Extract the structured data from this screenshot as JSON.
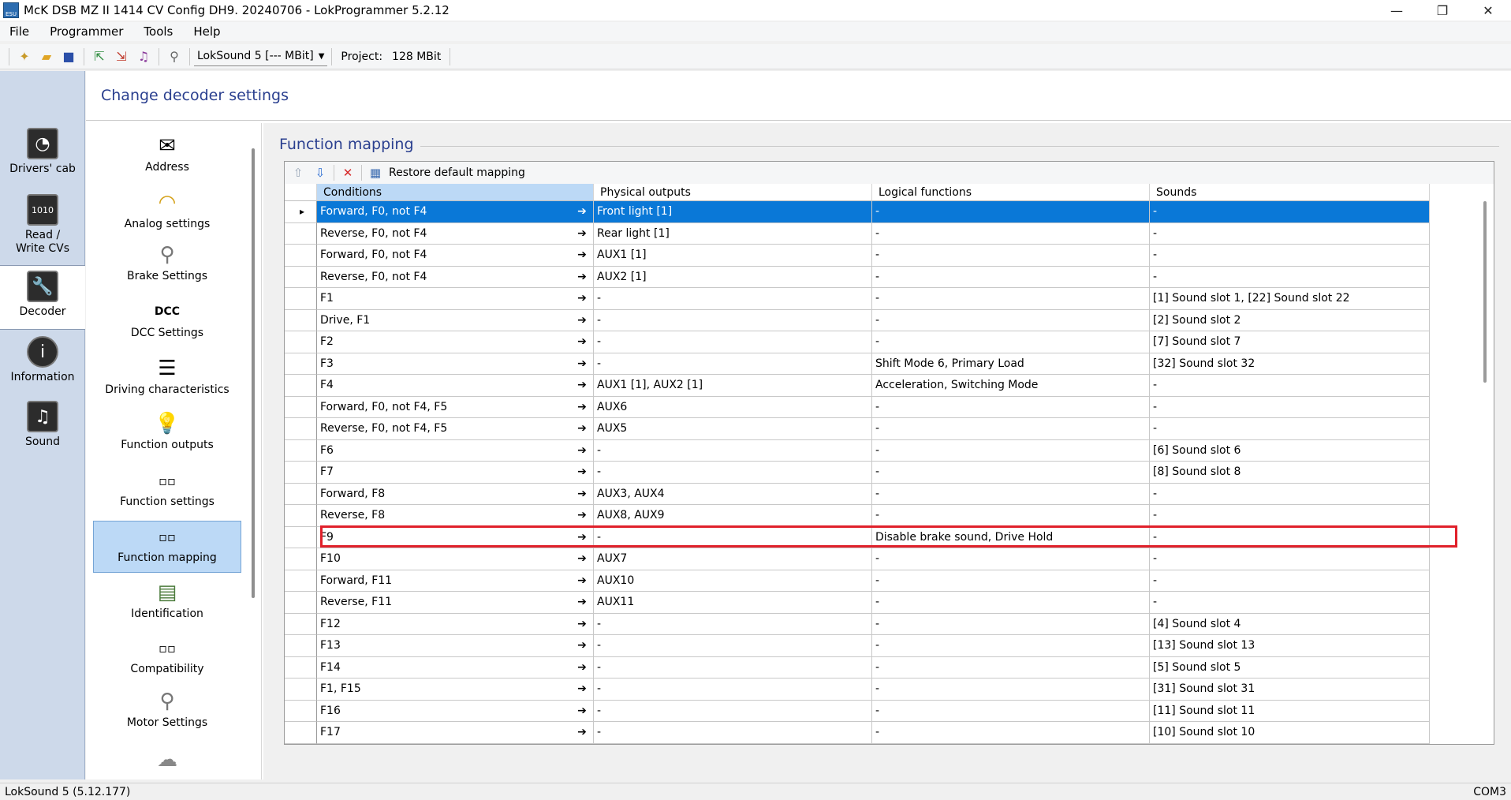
{
  "window": {
    "title": "McK DSB MZ II 1414 CV Config DH9. 20240706 - LokProgrammer 5.2.12",
    "controls": {
      "minimize": "—",
      "restore": "❐",
      "close": "✕"
    }
  },
  "menu": [
    "File",
    "Programmer",
    "Tools",
    "Help"
  ],
  "toolbar": {
    "decoder_combo": "LokSound 5 [--- MBit]",
    "project_label": "Project:",
    "project_value": "128 MBit"
  },
  "leftnav": [
    {
      "label": "Drivers' cab",
      "icon": "drivers-cab-icon"
    },
    {
      "label": "Read / Write CVs",
      "icon": "read-write-cvs-icon"
    },
    {
      "label": "Decoder",
      "icon": "decoder-wrench-icon",
      "active": true
    },
    {
      "label": "Information",
      "icon": "information-icon"
    },
    {
      "label": "Sound",
      "icon": "sound-notes-icon"
    }
  ],
  "main_title": "Change decoder settings",
  "categories": [
    {
      "label": "Address",
      "icon": "envelope-icon"
    },
    {
      "label": "Analog settings",
      "icon": "analog-gauge-icon"
    },
    {
      "label": "Brake Settings",
      "icon": "brake-lever-icon"
    },
    {
      "label": "DCC Settings",
      "icon": "dcc-icon"
    },
    {
      "label": "Driving characteristics",
      "icon": "sliders-icon"
    },
    {
      "label": "Function outputs",
      "icon": "light-bulb-icon"
    },
    {
      "label": "Function settings",
      "icon": "function-keys-icon"
    },
    {
      "label": "Function mapping",
      "icon": "function-keys-icon",
      "active": true
    },
    {
      "label": "Identification",
      "icon": "id-card-icon"
    },
    {
      "label": "Compatibility",
      "icon": "function-keys-icon"
    },
    {
      "label": "Motor Settings",
      "icon": "motor-lever-icon"
    },
    {
      "label": "",
      "icon": "smoke-icon"
    }
  ],
  "function_mapping": {
    "title": "Function mapping",
    "restore_label": "Restore default mapping",
    "columns": [
      "Conditions",
      "Physical outputs",
      "Logical functions",
      "Sounds"
    ],
    "rows": [
      {
        "conditions": "Forward, F0, not F4",
        "outputs": "Front light [1]",
        "logical": "-",
        "sounds": "-"
      },
      {
        "conditions": "Reverse, F0, not F4",
        "outputs": "Rear light [1]",
        "logical": "-",
        "sounds": "-"
      },
      {
        "conditions": "Forward, F0, not F4",
        "outputs": "AUX1 [1]",
        "logical": "-",
        "sounds": "-"
      },
      {
        "conditions": "Reverse, F0, not F4",
        "outputs": "AUX2 [1]",
        "logical": "-",
        "sounds": "-"
      },
      {
        "conditions": "F1",
        "outputs": "-",
        "logical": "-",
        "sounds": "[1] Sound slot 1, [22] Sound slot 22"
      },
      {
        "conditions": "Drive, F1",
        "outputs": "-",
        "logical": "-",
        "sounds": "[2] Sound slot 2"
      },
      {
        "conditions": "F2",
        "outputs": "-",
        "logical": "-",
        "sounds": "[7] Sound slot 7"
      },
      {
        "conditions": "F3",
        "outputs": "-",
        "logical": "Shift Mode 6, Primary Load",
        "sounds": "[32] Sound slot 32"
      },
      {
        "conditions": "F4",
        "outputs": "AUX1 [1], AUX2 [1]",
        "logical": "Acceleration, Switching Mode",
        "sounds": "-"
      },
      {
        "conditions": "Forward, F0, not F4, F5",
        "outputs": "AUX6",
        "logical": "-",
        "sounds": "-"
      },
      {
        "conditions": "Reverse, F0, not F4, F5",
        "outputs": "AUX5",
        "logical": "-",
        "sounds": "-"
      },
      {
        "conditions": "F6",
        "outputs": "-",
        "logical": "-",
        "sounds": "[6] Sound slot 6"
      },
      {
        "conditions": "F7",
        "outputs": "-",
        "logical": "-",
        "sounds": "[8] Sound slot 8"
      },
      {
        "conditions": "Forward, F8",
        "outputs": "AUX3, AUX4",
        "logical": "-",
        "sounds": "-"
      },
      {
        "conditions": "Reverse, F8",
        "outputs": "AUX8, AUX9",
        "logical": "-",
        "sounds": "-"
      },
      {
        "conditions": "F9",
        "outputs": "-",
        "logical": "Disable brake sound, Drive Hold",
        "sounds": "-"
      },
      {
        "conditions": "F10",
        "outputs": "AUX7",
        "logical": "-",
        "sounds": "-"
      },
      {
        "conditions": "Forward, F11",
        "outputs": "AUX10",
        "logical": "-",
        "sounds": "-"
      },
      {
        "conditions": "Reverse, F11",
        "outputs": "AUX11",
        "logical": "-",
        "sounds": "-"
      },
      {
        "conditions": "F12",
        "outputs": "-",
        "logical": "-",
        "sounds": "[4] Sound slot 4"
      },
      {
        "conditions": "F13",
        "outputs": "-",
        "logical": "-",
        "sounds": "[13] Sound slot 13"
      },
      {
        "conditions": "F14",
        "outputs": "-",
        "logical": "-",
        "sounds": "[5] Sound slot 5"
      },
      {
        "conditions": "F1, F15",
        "outputs": "-",
        "logical": "-",
        "sounds": "[31] Sound slot 31"
      },
      {
        "conditions": "F16",
        "outputs": "-",
        "logical": "-",
        "sounds": "[11] Sound slot 11"
      },
      {
        "conditions": "F17",
        "outputs": "-",
        "logical": "-",
        "sounds": "[10] Sound slot 10"
      }
    ],
    "selected_row": 0,
    "highlighted_row": 15
  },
  "status": {
    "left": "LokSound 5 (5.12.177)",
    "right": "COM3"
  },
  "colors": {
    "accent_title": "#2a3f8f",
    "selection": "#0a78d7",
    "highlight": "#e0202a"
  }
}
